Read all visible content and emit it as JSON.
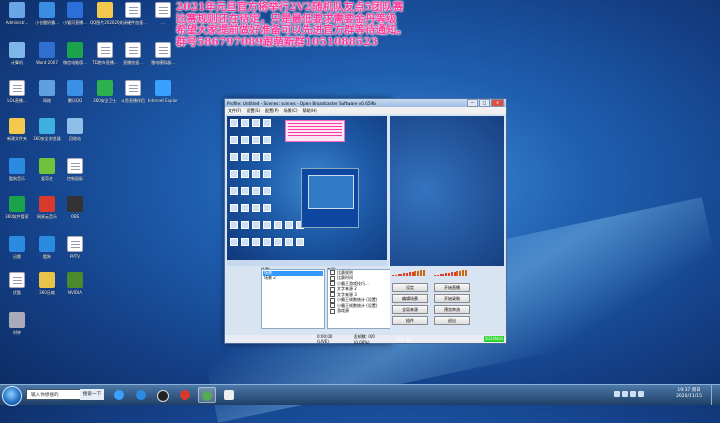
{
  "announcement": {
    "lines": [
      "2021年元旦官方将举行2V2随机队友点5团队赛",
      "比赛规则还在待定，只是最低要求需要金丹等级",
      "希望大家提前做好准备可以先进官方群等待通知。",
      "群号586797089跟萌新群1051088523"
    ]
  },
  "desktop": {
    "icons": [
      {
        "label": "Administr..."
      },
      {
        "label": "小仓酸奶霸..."
      },
      {
        "label": "小猫河直播..."
      },
      {
        "label": "QQ图片2020208..."
      },
      {
        "label": "关闭硬件加速..."
      },
      {
        "label": "..."
      },
      {
        "label": "计算机"
      },
      {
        "label": "Word 2007"
      },
      {
        "label": "微信电脑版..."
      },
      {
        "label": "TD跑车直播..."
      },
      {
        "label": "直播加速..."
      },
      {
        "label": "雷电模拟器..."
      },
      {
        "label": "LOL直播..."
      },
      {
        "label": "网络"
      },
      {
        "label": "腾讯QQ"
      },
      {
        "label": "360安全卫士"
      },
      {
        "label": "斗鱼直播伴侣"
      },
      {
        "label": "Internet Explorer"
      },
      {
        "label": "新建文件夹"
      },
      {
        "label": "360安全浏览器"
      },
      {
        "label": "回收站"
      },
      {
        "label": "酷狗音乐"
      },
      {
        "label": "爱奇艺"
      },
      {
        "label": "控制面板"
      },
      {
        "label": "360软件管家"
      },
      {
        "label": "网易云音乐"
      },
      {
        "label": "OBS"
      },
      {
        "label": "迅雷"
      },
      {
        "label": "酷狗"
      },
      {
        "label": "PPTV"
      },
      {
        "label": "优酷"
      },
      {
        "label": "360压缩"
      },
      {
        "label": "NVIDIA"
      },
      {
        "label": "时钟"
      }
    ]
  },
  "obs": {
    "title": "Profile: Untitled - Scenes: scenes - Open Broadcaster Software v0.659b",
    "menu": [
      "文件(F)",
      "设置(S)",
      "配置(P)",
      "场景(C)",
      "帮助(H)"
    ],
    "scenes_label": "场景:",
    "scenes": [
      "场景",
      "场景 2"
    ],
    "sources_label": "来源:",
    "sources": [
      "比赛规则",
      "比赛时间",
      "小霸王游戏技巧...",
      "文字来源 2",
      "文字来源 3",
      "小霸王帧数统计 (设置)",
      "小霸王帧数统计 (设置)",
      "游戏源"
    ],
    "buttons": [
      "设定",
      "开始直播",
      "编辑场景",
      "开始录制",
      "全局来源",
      "预览串流",
      "插件",
      "退出"
    ],
    "status": {
      "time": "0:00:00 (LIVE)",
      "dropped": "丢帧数: 0/0 (0.00%)",
      "fps": "FPS: 30",
      "kbps": "1024kb/s"
    }
  },
  "taskbar": {
    "search_placeholder": "输入你想搜的",
    "search_button": "搜索一下",
    "clock_time": "19:37 周日",
    "clock_date": "2020/11/15"
  }
}
